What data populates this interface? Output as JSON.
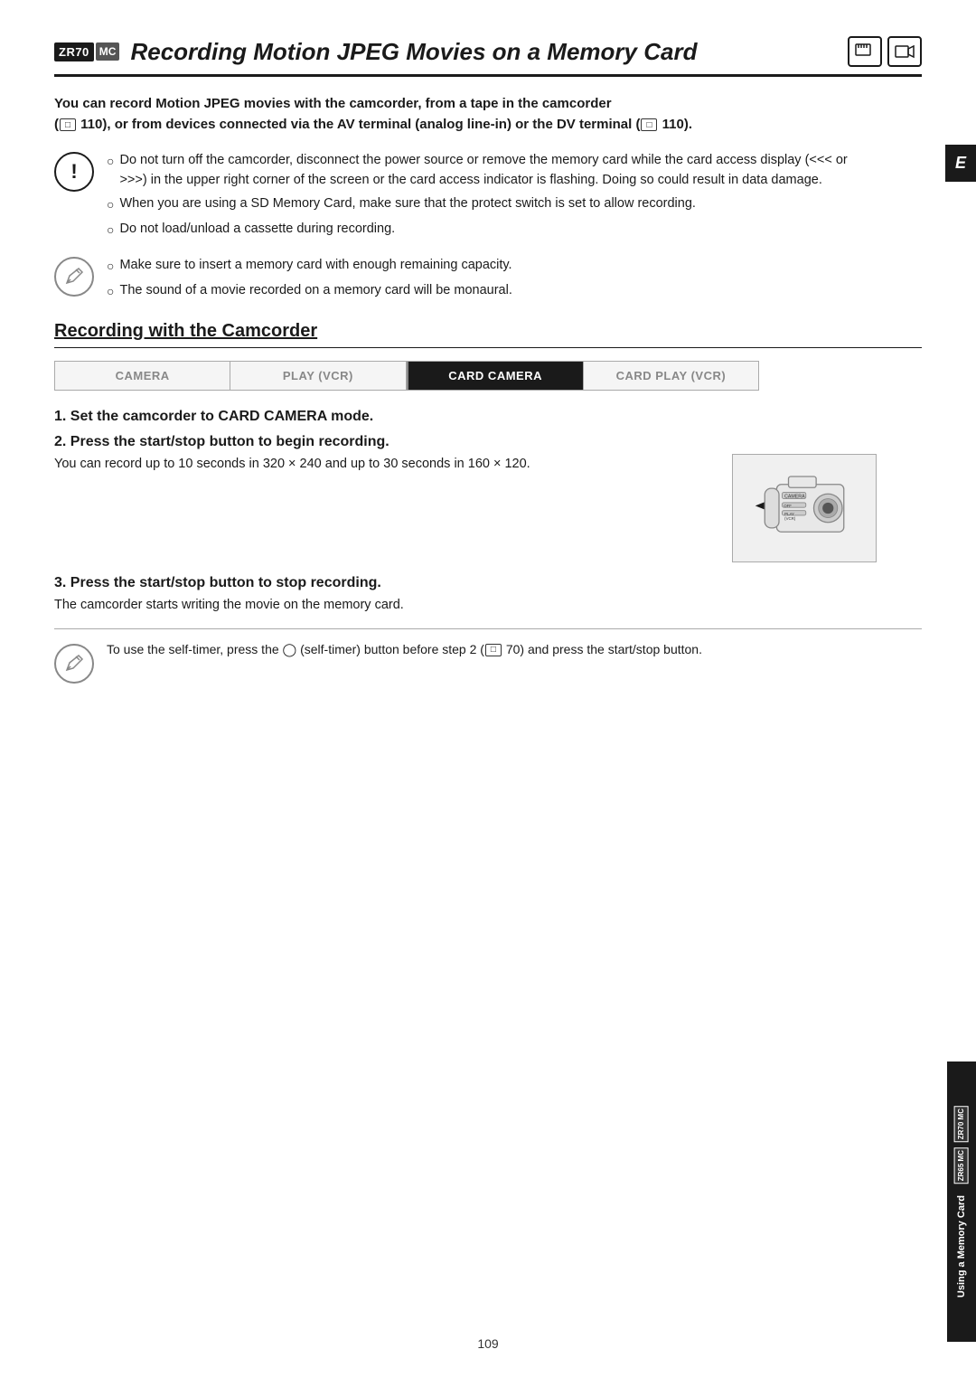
{
  "header": {
    "model_zr70": "ZR70",
    "model_mc": "MC",
    "title": "Recording Motion JPEG Movies on a Memory Card",
    "icon1": "📷",
    "icon2": "🎬"
  },
  "intro": {
    "text1": "You can record Motion JPEG movies with the camcorder, from a tape in the camcorder",
    "text2": "( 110), or from devices connected via the AV terminal (analog line-in) or the DV terminal (",
    "text3": " 110)."
  },
  "warning": {
    "bullets": [
      "Do not turn off the camcorder, disconnect the power source or remove the memory card while the card access display (<<< or >>>) in the upper right corner of the screen or the card access indicator is flashing. Doing so could result in data damage.",
      "When you are using a SD Memory Card, make sure that the protect switch is set to allow recording.",
      "Do not load/unload a cassette during recording."
    ]
  },
  "note1": {
    "bullets": [
      "Make sure to insert a memory card with enough remaining capacity.",
      "The sound of a movie recorded on a memory card will be monaural."
    ]
  },
  "section_heading": "Recording with the Camcorder",
  "tabs": {
    "items": [
      {
        "label": "CAMERA",
        "active": false
      },
      {
        "label": "PLAY (VCR)",
        "active": false
      },
      {
        "label": "CARD CAMERA",
        "active": true
      },
      {
        "label": "CARD PLAY (VCR)",
        "active": false
      }
    ]
  },
  "steps": {
    "step1": {
      "title": "1. Set the camcorder to CARD CAMERA mode.",
      "description": ""
    },
    "step2": {
      "title": "2. Press the start/stop button to begin recording.",
      "description": "You can record up to 10 seconds in 320 × 240 and up to 30 seconds in 160 × 120."
    },
    "step3": {
      "title": "3. Press the start/stop button to stop recording.",
      "description": "The camcorder starts writing the movie on the memory card."
    }
  },
  "note2": {
    "text_before": "To use the self-timer, press the",
    "self_timer_symbol": "⏱",
    "text_after": "(self-timer) button before step 2 (",
    "ref": "□",
    "ref_num": "70",
    "text_end": ") and press the start/stop button."
  },
  "sidebar": {
    "badge_zr70": "ZR70 MC",
    "badge_zr65": "ZR65 MC",
    "label": "Using a Memory Card"
  },
  "right_tab": {
    "letter": "E"
  },
  "page_number": "109"
}
